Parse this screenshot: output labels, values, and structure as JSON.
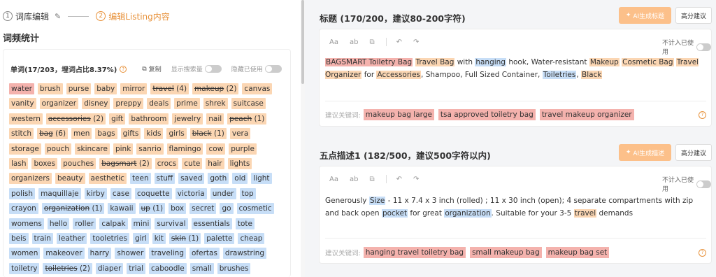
{
  "steps": {
    "step1_num": "1",
    "step1_label": "词库编辑",
    "step2_num": "2",
    "step2_label": "编辑Listing内容"
  },
  "left": {
    "section_title": "词频统计",
    "stat_label": "单词(17/203，埋词占比8.37%)",
    "copy_label": "复制",
    "toggle1_label": "显示搜索量",
    "toggle2_label": "隐藏已使用"
  },
  "tag_rows": [
    [
      {
        "w": "water",
        "c": "red"
      },
      {
        "w": "brush",
        "c": "orange"
      },
      {
        "w": "purse",
        "c": "orange"
      },
      {
        "w": "baby",
        "c": "orange"
      },
      {
        "w": "mirror",
        "c": "orange"
      },
      {
        "w": "travel",
        "c": "orange",
        "s": true,
        "n": "(4)"
      },
      {
        "w": "makeup",
        "c": "orange",
        "s": true,
        "n": "(2)"
      },
      {
        "w": "canvas",
        "c": "orange"
      }
    ],
    [
      {
        "w": "vanity",
        "c": "orange"
      },
      {
        "w": "organizer",
        "c": "orange"
      },
      {
        "w": "disney",
        "c": "orange"
      },
      {
        "w": "preppy",
        "c": "orange"
      },
      {
        "w": "deals",
        "c": "orange"
      },
      {
        "w": "prime",
        "c": "orange"
      },
      {
        "w": "shrek",
        "c": "orange"
      },
      {
        "w": "suitcase",
        "c": "orange"
      }
    ],
    [
      {
        "w": "western",
        "c": "orange"
      },
      {
        "w": "accessories",
        "c": "orange",
        "s": true,
        "n": "(2)"
      },
      {
        "w": "gift",
        "c": "orange"
      },
      {
        "w": "bathroom",
        "c": "orange"
      },
      {
        "w": "jewelry",
        "c": "orange"
      },
      {
        "w": "nail",
        "c": "orange"
      },
      {
        "w": "peach",
        "c": "orange",
        "s": true,
        "n": "(1)"
      }
    ],
    [
      {
        "w": "stitch",
        "c": "orange"
      },
      {
        "w": "bag",
        "c": "orange",
        "s": true,
        "n": "(6)"
      },
      {
        "w": "men",
        "c": "orange"
      },
      {
        "w": "bags",
        "c": "orange"
      },
      {
        "w": "gifts",
        "c": "orange"
      },
      {
        "w": "kids",
        "c": "orange"
      },
      {
        "w": "girls",
        "c": "orange"
      },
      {
        "w": "black",
        "c": "orange",
        "s": true,
        "n": "(1)"
      },
      {
        "w": "vera",
        "c": "orange"
      }
    ],
    [
      {
        "w": "storage",
        "c": "orange"
      },
      {
        "w": "pouch",
        "c": "orange"
      },
      {
        "w": "skincare",
        "c": "orange"
      },
      {
        "w": "pink",
        "c": "orange"
      },
      {
        "w": "sanrio",
        "c": "orange"
      },
      {
        "w": "flamingo",
        "c": "orange"
      },
      {
        "w": "cow",
        "c": "orange"
      },
      {
        "w": "purple",
        "c": "orange"
      }
    ],
    [
      {
        "w": "lash",
        "c": "orange"
      },
      {
        "w": "boxes",
        "c": "orange"
      },
      {
        "w": "pouches",
        "c": "orange"
      },
      {
        "w": "bagsmart",
        "c": "orange",
        "s": true,
        "n": "(2)"
      },
      {
        "w": "crocs",
        "c": "orange"
      },
      {
        "w": "cute",
        "c": "orange"
      },
      {
        "w": "hair",
        "c": "orange"
      },
      {
        "w": "lights",
        "c": "orange"
      }
    ],
    [
      {
        "w": "organizers",
        "c": "orange"
      },
      {
        "w": "beauty",
        "c": "orange"
      },
      {
        "w": "aesthetic",
        "c": "orange"
      },
      {
        "w": "teen",
        "c": "blue"
      },
      {
        "w": "stuff",
        "c": "blue"
      },
      {
        "w": "saved",
        "c": "blue"
      },
      {
        "w": "goth",
        "c": "blue"
      },
      {
        "w": "old",
        "c": "blue"
      },
      {
        "w": "light",
        "c": "blue"
      }
    ],
    [
      {
        "w": "polish",
        "c": "blue"
      },
      {
        "w": "maquillaje",
        "c": "blue"
      },
      {
        "w": "kirby",
        "c": "blue"
      },
      {
        "w": "case",
        "c": "blue"
      },
      {
        "w": "coquette",
        "c": "blue"
      },
      {
        "w": "victoria",
        "c": "blue"
      },
      {
        "w": "under",
        "c": "blue"
      },
      {
        "w": "top",
        "c": "blue"
      }
    ],
    [
      {
        "w": "crayon",
        "c": "blue"
      },
      {
        "w": "organization",
        "c": "blue",
        "s": true,
        "n": "(1)"
      },
      {
        "w": "kawaii",
        "c": "blue"
      },
      {
        "w": "up",
        "c": "blue",
        "s": true,
        "n": "(1)"
      },
      {
        "w": "box",
        "c": "blue"
      },
      {
        "w": "secret",
        "c": "blue"
      },
      {
        "w": "go",
        "c": "blue"
      },
      {
        "w": "cosmetic",
        "c": "blue"
      }
    ],
    [
      {
        "w": "womens",
        "c": "blue"
      },
      {
        "w": "hello",
        "c": "blue"
      },
      {
        "w": "roller",
        "c": "blue"
      },
      {
        "w": "calpak",
        "c": "blue"
      },
      {
        "w": "mini",
        "c": "blue"
      },
      {
        "w": "survival",
        "c": "blue"
      },
      {
        "w": "essentials",
        "c": "blue"
      },
      {
        "w": "tote",
        "c": "blue"
      }
    ],
    [
      {
        "w": "beis",
        "c": "blue"
      },
      {
        "w": "train",
        "c": "blue"
      },
      {
        "w": "leather",
        "c": "blue"
      },
      {
        "w": "tooletries",
        "c": "blue"
      },
      {
        "w": "girl",
        "c": "blue"
      },
      {
        "w": "kit",
        "c": "blue"
      },
      {
        "w": "skin",
        "c": "blue",
        "s": true,
        "n": "(1)"
      },
      {
        "w": "palette",
        "c": "blue"
      },
      {
        "w": "cheap",
        "c": "blue"
      }
    ],
    [
      {
        "w": "women",
        "c": "blue"
      },
      {
        "w": "makeover",
        "c": "blue"
      },
      {
        "w": "harry",
        "c": "blue"
      },
      {
        "w": "shower",
        "c": "blue"
      },
      {
        "w": "traveling",
        "c": "blue"
      },
      {
        "w": "ofertas",
        "c": "blue"
      },
      {
        "w": "drawstring",
        "c": "blue"
      }
    ],
    [
      {
        "w": "toiletry",
        "c": "blue"
      },
      {
        "w": "toiletries",
        "c": "blue",
        "s": true,
        "n": "(2)"
      },
      {
        "w": "diaper",
        "c": "blue"
      },
      {
        "w": "trial",
        "c": "blue"
      },
      {
        "w": "caboodle",
        "c": "blue"
      },
      {
        "w": "small",
        "c": "blue"
      },
      {
        "w": "brushes",
        "c": "blue"
      }
    ]
  ],
  "title_block": {
    "heading": "标题 (170/200，建议80-200字符)",
    "ai_label": "AI生成标题",
    "adv_label": "高分建议",
    "toolbar": [
      "Aa",
      "ab",
      "⧉",
      "↶",
      "↷"
    ],
    "ignore_label": "不计入已使用",
    "content": [
      {
        "t": "BAGSMART Toiletry Bag",
        "c": "red"
      },
      {
        "t": " "
      },
      {
        "t": "Travel Bag",
        "c": "orange"
      },
      {
        "t": " with "
      },
      {
        "t": "hanging",
        "c": "blue"
      },
      {
        "t": " hook, Water-resistant "
      },
      {
        "t": "Makeup",
        "c": "orange"
      },
      {
        "t": " "
      },
      {
        "t": "Cosmetic Bag",
        "c": "orange"
      },
      {
        "t": " "
      },
      {
        "t": "Travel Organizer",
        "c": "orange"
      },
      {
        "t": " for "
      },
      {
        "t": "Accessories",
        "c": "orange"
      },
      {
        "t": ", Shampoo, Full Sized Container, "
      },
      {
        "t": "Toiletries",
        "c": "blue"
      },
      {
        "t": ", "
      },
      {
        "t": "Black",
        "c": "orange"
      }
    ],
    "suggest_label": "建议关键词:",
    "suggest": [
      "makeup bag large",
      "tsa approved toiletry bag",
      "travel makeup organizer"
    ],
    "help": "?"
  },
  "bullet_block": {
    "heading": "五点描述1 (182/500，建议500字符以内)",
    "ai_label": "AI生成描述",
    "adv_label": "高分建议",
    "toolbar": [
      "Aa",
      "ab",
      "⧉",
      "↶",
      "↷"
    ],
    "ignore_label": "不计入已使用",
    "content": [
      {
        "t": "Generously "
      },
      {
        "t": "Size",
        "c": "blue"
      },
      {
        "t": " - 11 x 7.4 x 3 inch (rolled) ; 11 x 30 inch (open); 4 separate compartments with zip and back open "
      },
      {
        "t": "pocket",
        "c": "blue"
      },
      {
        "t": " for great "
      },
      {
        "t": "organization",
        "c": "blue"
      },
      {
        "t": ". Suitable for your 3-5 "
      },
      {
        "t": "travel",
        "c": "orange"
      },
      {
        "t": " demands"
      }
    ],
    "suggest_label": "建议关键词:",
    "suggest": [
      "hanging travel toiletry bag",
      "small makeup bag",
      "makeup bag set"
    ],
    "help": "?"
  },
  "colors": {
    "accent": "#e8923b",
    "red_tag": "#f4b2ad",
    "orange_tag": "#fbd6b3",
    "blue_tag": "#c7def7"
  }
}
